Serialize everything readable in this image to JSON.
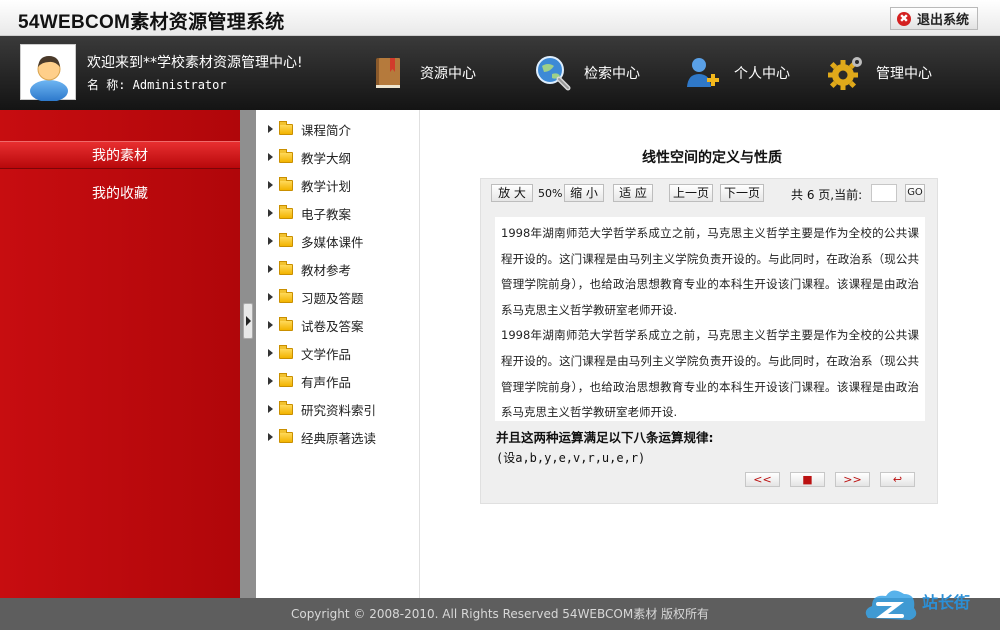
{
  "app": {
    "title": "54WEBCOM素材资源管理系统",
    "exit_label": "退出系统"
  },
  "header": {
    "welcome": "欢迎来到**学校素材资源管理中心!",
    "user_label": "名 称: Administrator",
    "nav": [
      {
        "label": "资源中心",
        "icon": "book-icon"
      },
      {
        "label": "检索中心",
        "icon": "search-globe-icon"
      },
      {
        "label": "个人中心",
        "icon": "user-add-icon"
      },
      {
        "label": "管理中心",
        "icon": "gear-icon"
      }
    ]
  },
  "sidebar": {
    "items": [
      "我的素材",
      "我的收藏"
    ],
    "active": 0
  },
  "tree": {
    "items": [
      "课程简介",
      "教学大纲",
      "教学计划",
      "电子教案",
      "多媒体课件",
      "教材参考",
      "习题及答题",
      "试卷及答案",
      "文学作品",
      "有声作品",
      "研究资料索引",
      "经典原著选读"
    ]
  },
  "document": {
    "title": "线性空间的定义与性质",
    "toolbar": {
      "zoom_in": "放 大",
      "zoom_value": "50%",
      "zoom_out": "缩 小",
      "fit": "适 应",
      "prev": "上一页",
      "next": "下一页",
      "page_info": "共 6 页,当前:",
      "go": "GO"
    },
    "paragraphs": [
      "1998年湖南师范大学哲学系成立之前，马克思主义哲学主要是作为全校的公共课程开设的。这门课程是由马列主义学院负责开设的。与此同时，在政治系（现公共管理学院前身），也给政治思想教育专业的本科生开设该门课程。该课程是由政治系马克思主义哲学教研室老师开设.",
      "1998年湖南师范大学哲学系成立之前，马克思主义哲学主要是作为全校的公共课程开设的。这门课程是由马列主义学院负责开设的。与此同时，在政治系（现公共管理学院前身），也给政治思想教育专业的本科生开设该门课程。该课程是由政治系马克思主义哲学教研室老师开设."
    ],
    "rule_heading": "并且这两种运算满足以下八条运算规律:",
    "rule_sub": "(设a,b,y,e,v,r,u,e,r)",
    "nav_buttons": [
      "<<",
      "■",
      ">>",
      "↩"
    ]
  },
  "footer": {
    "text": "Copyright © 2008-2010. All Rights Reserved 54WEBCOM素材 版权所有"
  },
  "colors": {
    "sidebar_red": "#c70d10",
    "header_dark": "#1e1e1e",
    "footer_gray": "#5e5e5e"
  }
}
